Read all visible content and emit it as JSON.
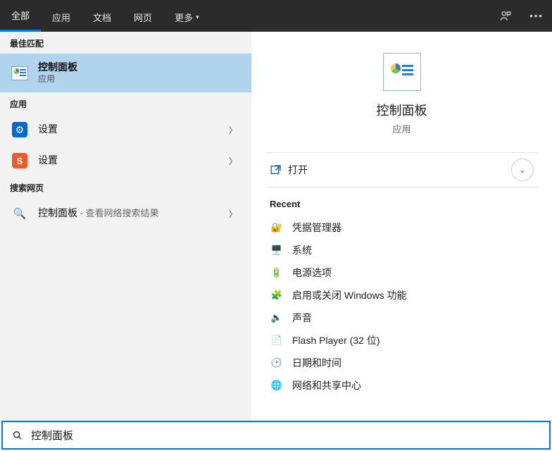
{
  "tabs": {
    "all": "全部",
    "apps": "应用",
    "docs": "文档",
    "web": "网页",
    "more": "更多"
  },
  "left": {
    "best_match_header": "最佳匹配",
    "best_match": {
      "title": "控制面板",
      "subtitle": "应用"
    },
    "apps_header": "应用",
    "apps": [
      {
        "title": "设置"
      },
      {
        "title": "设置"
      }
    ],
    "web_header": "搜索网页",
    "web": {
      "title": "控制面板",
      "suffix": " - 查看网络搜索结果"
    }
  },
  "preview": {
    "title": "控制面板",
    "subtitle": "应用",
    "open_label": "打开",
    "recent_header": "Recent",
    "recent": [
      {
        "icon": "🔐",
        "label": "凭据管理器"
      },
      {
        "icon": "🖥️",
        "label": "系统"
      },
      {
        "icon": "🔋",
        "label": "电源选项"
      },
      {
        "icon": "🧩",
        "label": "启用或关闭 Windows 功能"
      },
      {
        "icon": "🔈",
        "label": "声音"
      },
      {
        "icon": "📄",
        "label": "Flash Player (32 位)"
      },
      {
        "icon": "🕑",
        "label": "日期和时间"
      },
      {
        "icon": "🌐",
        "label": "网络和共享中心"
      }
    ]
  },
  "search": {
    "value": "控制面板"
  }
}
